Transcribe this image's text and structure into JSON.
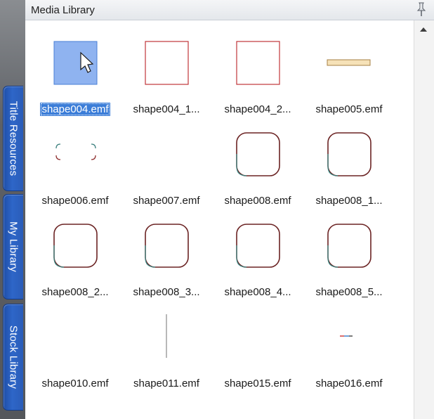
{
  "panel": {
    "title": "Media Library"
  },
  "tabs": [
    {
      "label": "Title Resources"
    },
    {
      "label": "My Library"
    },
    {
      "label": "Stock Library"
    }
  ],
  "items": [
    {
      "label": "shape004.emf",
      "icon": "selected-square-icon"
    },
    {
      "label": "shape004_1...",
      "icon": "red-square-icon"
    },
    {
      "label": "shape004_2...",
      "icon": "red-square-icon"
    },
    {
      "label": "shape005.emf",
      "icon": "horizontal-bar-icon"
    },
    {
      "label": "shape006.emf",
      "icon": "dashed-rounded-rect-icon"
    },
    {
      "label": "shape007.emf",
      "icon": "blank-shape-icon"
    },
    {
      "label": "shape008.emf",
      "icon": "rounded-square-icon"
    },
    {
      "label": "shape008_1...",
      "icon": "rounded-square-icon"
    },
    {
      "label": "shape008_2...",
      "icon": "rounded-square-icon"
    },
    {
      "label": "shape008_3...",
      "icon": "rounded-square-icon"
    },
    {
      "label": "shape008_4...",
      "icon": "rounded-square-icon"
    },
    {
      "label": "shape008_5...",
      "icon": "rounded-square-icon"
    },
    {
      "label": "shape010.emf",
      "icon": "blank-shape-icon"
    },
    {
      "label": "shape011.emf",
      "icon": "vertical-line-icon"
    },
    {
      "label": "shape015.emf",
      "icon": "blank-shape-icon"
    },
    {
      "label": "shape016.emf",
      "icon": "small-line-icon"
    }
  ],
  "colors": {
    "accent": "#3b7dd8",
    "tab_blue": "#2e66c8",
    "shape_red": "#c0353a",
    "shape_maroon": "#6b2323"
  }
}
